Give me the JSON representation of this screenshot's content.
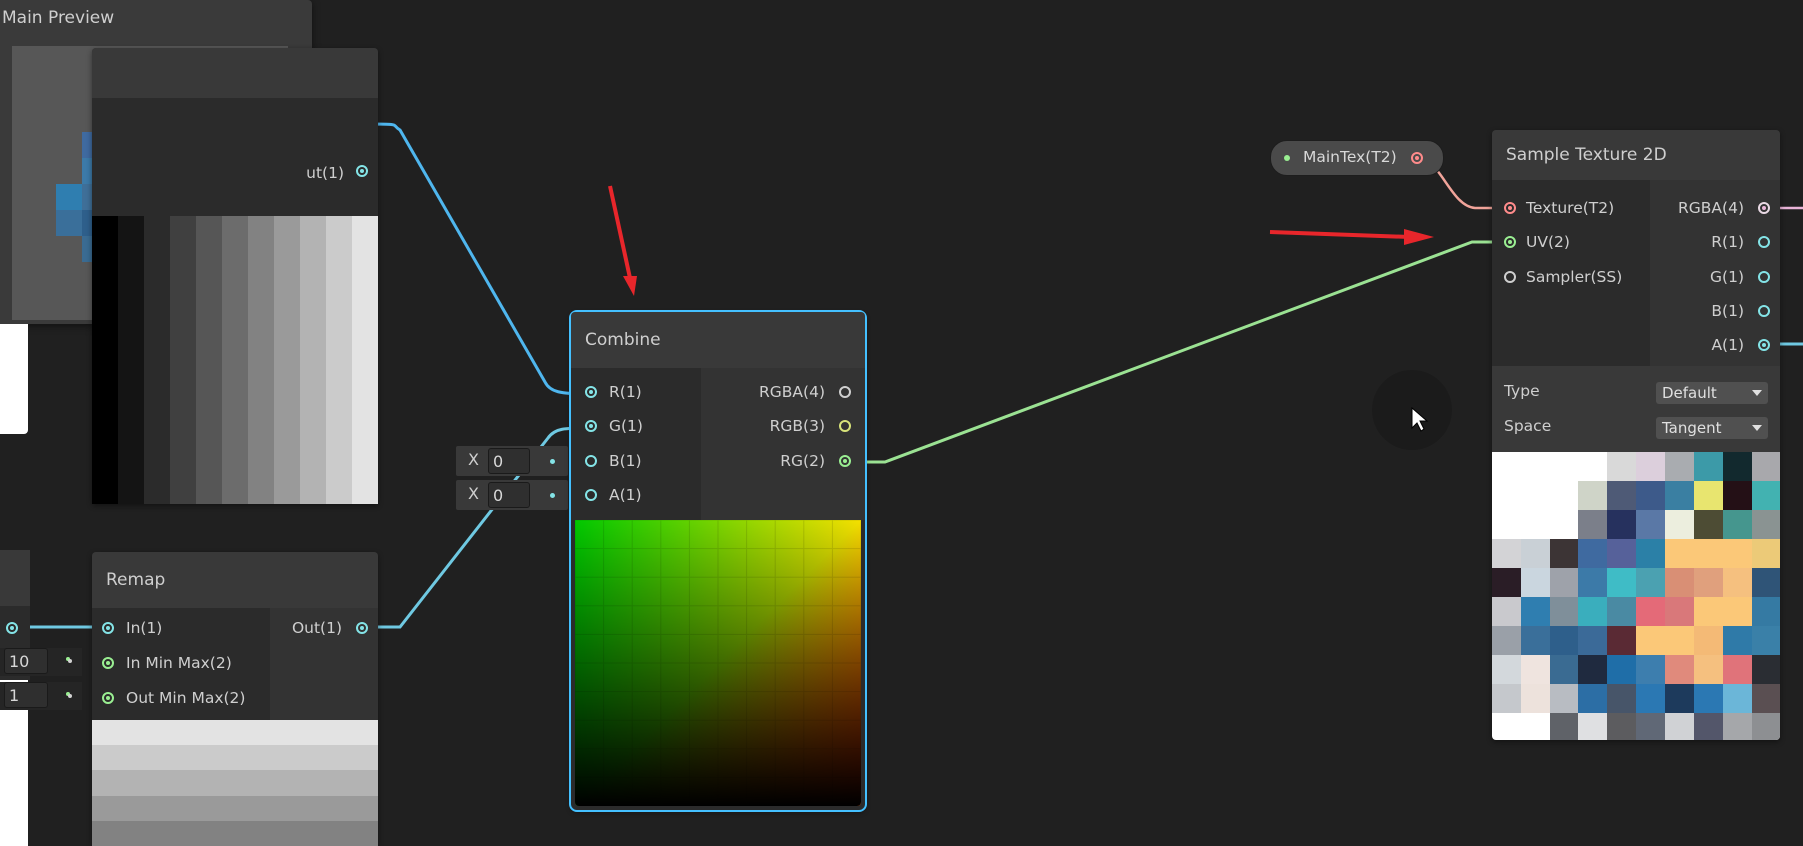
{
  "main_preview": {
    "title": "Main Preview"
  },
  "top_left_node": {
    "out_label": "ut(1)"
  },
  "remap": {
    "title": "Remap",
    "inputs": [
      "In(1)",
      "In Min Max(2)",
      "Out Min Max(2)"
    ],
    "output": "Out(1)",
    "in_min_max_value": "10",
    "out_min_max_value": "1"
  },
  "combine": {
    "title": "Combine",
    "inputs": [
      "R(1)",
      "G(1)",
      "B(1)",
      "A(1)"
    ],
    "outputs": [
      "RGBA(4)",
      "RGB(3)",
      "RG(2)"
    ],
    "b_field": {
      "axis": "X",
      "value": "0"
    },
    "a_field": {
      "axis": "X",
      "value": "0"
    }
  },
  "maintex": {
    "label": "MainTex(T2)"
  },
  "sample_texture": {
    "title": "Sample Texture 2D",
    "inputs": [
      "Texture(T2)",
      "UV(2)",
      "Sampler(SS)"
    ],
    "outputs": [
      "RGBA(4)",
      "R(1)",
      "G(1)",
      "B(1)",
      "A(1)"
    ],
    "type_label": "Type",
    "type_value": "Default",
    "space_label": "Space",
    "space_value": "Tangent"
  },
  "colors": {
    "background": "#202020",
    "float_port": "#84e4e7",
    "vector2_port": "#9aef92",
    "texture_port": "#ff8b8b",
    "selection": "#44c0ff",
    "annotation_arrow": "#e8262b"
  },
  "icons": [
    "cursor-icon",
    "annotation-arrow-icon",
    "dropdown-caret-icon"
  ]
}
